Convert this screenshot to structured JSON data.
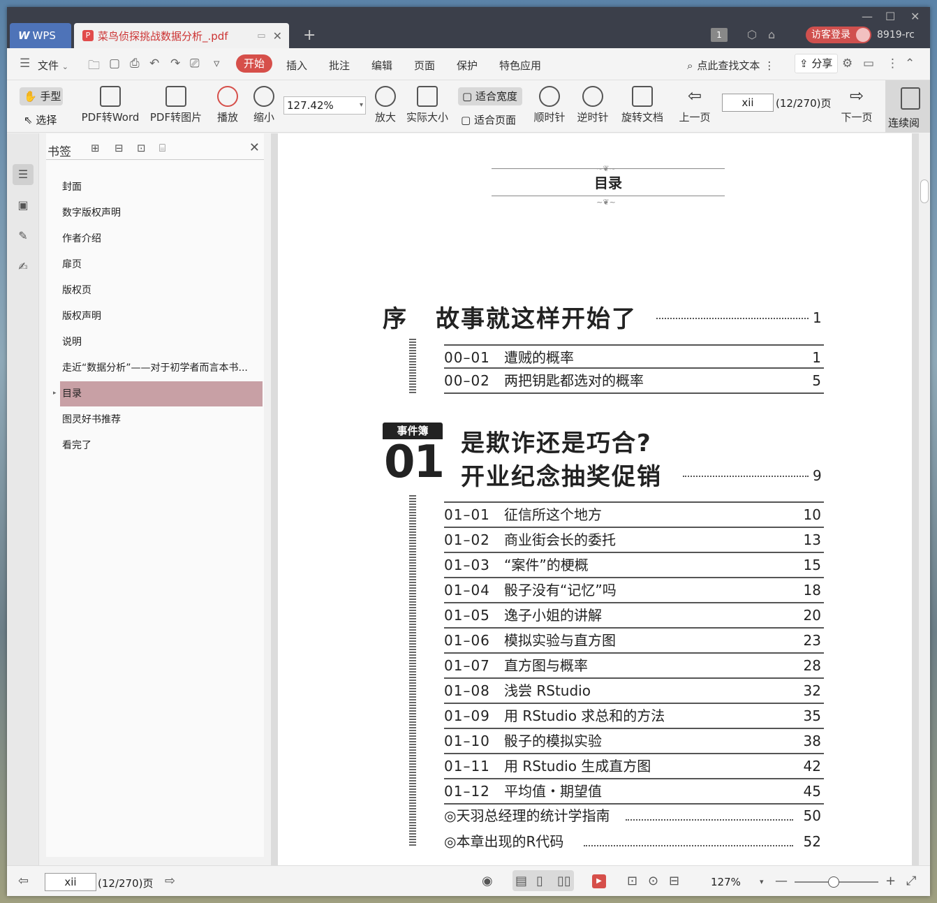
{
  "titlebar": {
    "app_tab": "WPS",
    "doc_tab": "菜鸟侦探挑战数据分析_.pdf",
    "page_badge": "1",
    "login": "访客登录",
    "user": "8919-rc"
  },
  "menubar": {
    "file": "文件",
    "items": [
      "开始",
      "插入",
      "批注",
      "编辑",
      "页面",
      "保护",
      "特色应用"
    ],
    "search": "点此查找文本",
    "share": "分享"
  },
  "ribbon": {
    "hand": "手型",
    "select": "选择",
    "pdf_to_word": "PDF转Word",
    "pdf_to_image": "PDF转图片",
    "play": "播放",
    "zoom_out": "缩小",
    "zoom_value": "127.42%",
    "zoom_in": "放大",
    "actual_size": "实际大小",
    "fit_width": "适合宽度",
    "fit_page": "适合页面",
    "rotate_cw": "顺时针",
    "rotate_ccw": "逆时针",
    "rotate_doc": "旋转文档",
    "prev_page": "上一页",
    "page_value": "xii",
    "page_of": "(12/270)页",
    "next_page": "下一页",
    "continuous": "连续阅"
  },
  "bookmarks": {
    "title": "书签",
    "items": [
      "封面",
      "数字版权声明",
      "作者介绍",
      "扉页",
      "版权页",
      "版权声明",
      "说明",
      "走近“数据分析”——对于初学者而言本书...",
      "目录",
      "图灵好书推荐",
      "看完了"
    ]
  },
  "toc": {
    "heading": "目录",
    "preface": {
      "label": "序",
      "title": "故事就这样开始了",
      "page": "1"
    },
    "preface_entries": [
      {
        "num": "00–01",
        "title": "遭贼的概率",
        "page": "1"
      },
      {
        "num": "00–02",
        "title": "两把钥匙都选对的概率",
        "page": "5"
      }
    ],
    "chapter": {
      "badge": "事件簿",
      "number": "01",
      "title_line1": "是欺诈还是巧合?",
      "title_line2": "开业纪念抽奖促销",
      "page": "9"
    },
    "chapter_entries": [
      {
        "num": "01–01",
        "title": "征信所这个地方",
        "page": "10"
      },
      {
        "num": "01–02",
        "title": "商业街会长的委托",
        "page": "13"
      },
      {
        "num": "01–03",
        "title": "“案件”的梗概",
        "page": "15"
      },
      {
        "num": "01–04",
        "title": "骰子没有“记忆”吗",
        "page": "18"
      },
      {
        "num": "01–05",
        "title": "逸子小姐的讲解",
        "page": "20"
      },
      {
        "num": "01–06",
        "title": "模拟实验与直方图",
        "page": "23"
      },
      {
        "num": "01–07",
        "title": "直方图与概率",
        "page": "28"
      },
      {
        "num": "01–08",
        "title": "浅尝 RStudio",
        "page": "32"
      },
      {
        "num": "01–09",
        "title": "用 RStudio 求总和的方法",
        "page": "35"
      },
      {
        "num": "01–10",
        "title": "骰子的模拟实验",
        "page": "38"
      },
      {
        "num": "01–11",
        "title": "用 RStudio 生成直方图",
        "page": "42"
      },
      {
        "num": "01–12",
        "title": "平均值・期望值",
        "page": "45"
      }
    ],
    "guides": [
      {
        "title": "◎天羽总经理的统计学指南",
        "page": "50"
      },
      {
        "title": "◎本章出现的R代码",
        "page": "52"
      }
    ]
  },
  "statusbar": {
    "page_value": "xii",
    "page_of": "(12/270)页",
    "zoom": "127%"
  }
}
